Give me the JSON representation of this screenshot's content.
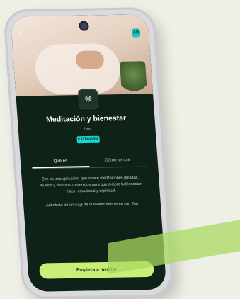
{
  "app": {
    "title": "Meditación y bienestar",
    "developer": "Zen",
    "category_badge": "CATEGORÍA",
    "badge_small": "AD",
    "tabs": [
      {
        "label": "Qué es",
        "active": true
      },
      {
        "label": "Cómo se usa",
        "active": false
      }
    ],
    "description": [
      "Zen es una aplicación que ofrece meditaciones guiadas, música y diversos contenidos para que mejore tu bienestar físico, emocional y espiritual.",
      "Adéntrate en un viaje de autodescubrimiento con Zen"
    ],
    "cta_label": "Empieza a meditar",
    "colors": {
      "screen_bg": "#0e2218",
      "accent_teal": "#19d7cf",
      "cta_green": "#c9ef79",
      "page_bg": "#eef0e6"
    },
    "icons": {
      "app_icon": "meditation-icon",
      "back": "back-arrow-icon"
    }
  }
}
